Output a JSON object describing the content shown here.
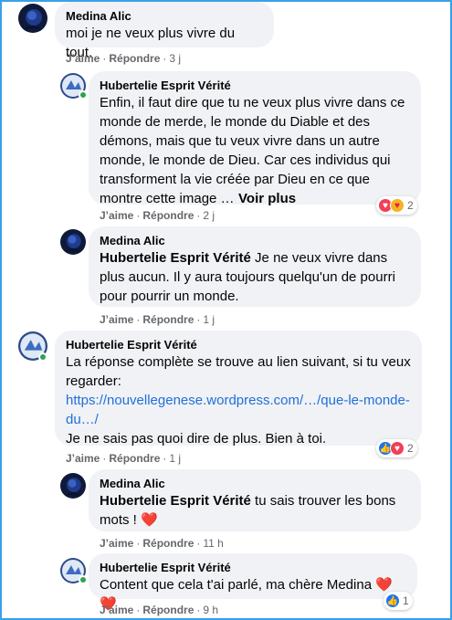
{
  "colors": {
    "link": "#216fdb",
    "bubble": "#f0f2f5",
    "online": "#31a24c",
    "heart": "#e41e3f",
    "like": "#1877f2"
  },
  "comments": [
    {
      "author": "Medina Alic",
      "text": "moi je ne veux plus vivre du tout.",
      "like": "J’aime",
      "reply": "Répondre",
      "time": "3 j"
    },
    {
      "author": "Hubertelie Esprit Vérité",
      "text": "Enfin, il faut dire que tu ne veux plus vivre dans ce monde de merde, le monde du Diable et des démons, mais que tu veux vivre dans un autre monde, le monde de Dieu. Car ces individus qui transforment la vie créée par Dieu en ce que montre cette image …",
      "see_more": "Voir plus",
      "like": "J’aime",
      "reply": "Répondre",
      "time": "2 j",
      "reaction_count": "2",
      "reaction_icons": [
        "love-reaction",
        "care-reaction"
      ]
    },
    {
      "author": "Medina Alic",
      "mention": "Hubertelie Esprit Vérité",
      "text": " Je ne veux vivre dans plus aucun. Il y aura toujours quelqu'un de pourri pour pourrir un monde.",
      "like": "J’aime",
      "reply": "Répondre",
      "time": "1 j"
    },
    {
      "author": "Hubertelie Esprit Vérité",
      "text_before": "La réponse complète se trouve au lien suivant, si tu veux regarder:",
      "link": "https://nouvellegenese.wordpress.com/…/que-le-monde-du…/",
      "text_after": "Je ne sais pas quoi dire de plus. Bien à toi.",
      "like": "J’aime",
      "reply": "Répondre",
      "time": "1 j",
      "reaction_count": "2",
      "reaction_icons": [
        "like-reaction",
        "love-reaction"
      ]
    },
    {
      "author": "Medina Alic",
      "mention": "Hubertelie Esprit Vérité",
      "text": " tu sais trouver les bons mots !",
      "emoji": "❤️",
      "like": "J’aime",
      "reply": "Répondre",
      "time": "11 h"
    },
    {
      "author": "Hubertelie Esprit Vérité",
      "text": "Content que cela t'ai parlé, ma chère Medina",
      "emoji": "❤️❤️",
      "like": "J’aime",
      "reply": "Répondre",
      "time": "9 h",
      "reaction_count": "1",
      "reaction_icons": [
        "like-reaction"
      ]
    }
  ]
}
